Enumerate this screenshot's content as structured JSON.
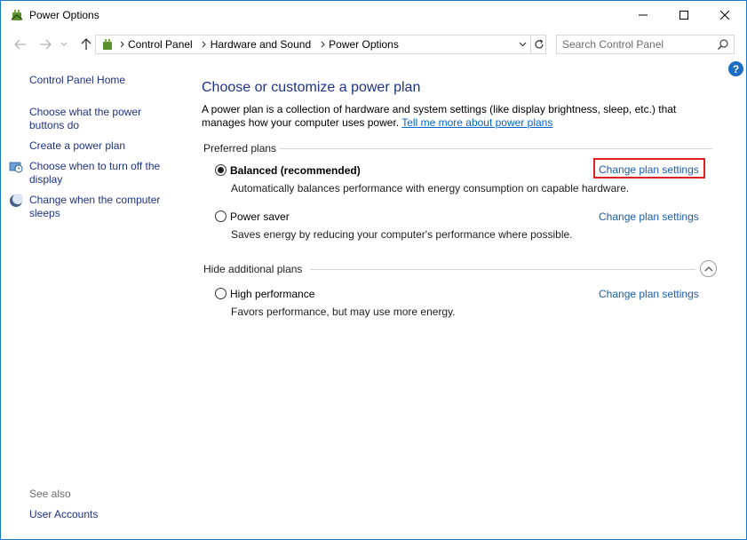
{
  "window": {
    "title": "Power Options"
  },
  "address_bar": {
    "breadcrumbs": [
      "Control Panel",
      "Hardware and Sound",
      "Power Options"
    ]
  },
  "search": {
    "placeholder": "Search Control Panel"
  },
  "left_pane": {
    "home": "Control Panel Home",
    "links": [
      {
        "label": "Choose what the power buttons do"
      },
      {
        "label": "Create a power plan"
      },
      {
        "label": "Choose when to turn off the display",
        "icon": "display-clock-icon"
      },
      {
        "label": "Change when the computer sleeps",
        "icon": "moon-icon"
      }
    ],
    "see_also": "See also",
    "see_also_links": [
      "User Accounts"
    ]
  },
  "main": {
    "title": "Choose or customize a power plan",
    "description": "A power plan is a collection of hardware and system settings (like display brightness, sleep, etc.) that manages how your computer uses power.",
    "more_link": "Tell me more about power plans",
    "preferred_header": "Preferred plans",
    "additional_header": "Hide additional plans",
    "plans": [
      {
        "name": "Balanced (recommended)",
        "description": "Automatically balances performance with energy consumption on capable hardware.",
        "link": "Change plan settings",
        "selected": true
      },
      {
        "name": "Power saver",
        "description": "Saves energy by reducing your computer's performance where possible.",
        "link": "Change plan settings",
        "selected": false
      },
      {
        "name": "High performance",
        "description": "Favors performance, but may use more energy.",
        "link": "Change plan settings",
        "selected": false
      }
    ]
  },
  "colors": {
    "link": "#1e5ca8",
    "title": "#1e3287",
    "highlight": "#e02020",
    "help": "#1b6ec2"
  }
}
